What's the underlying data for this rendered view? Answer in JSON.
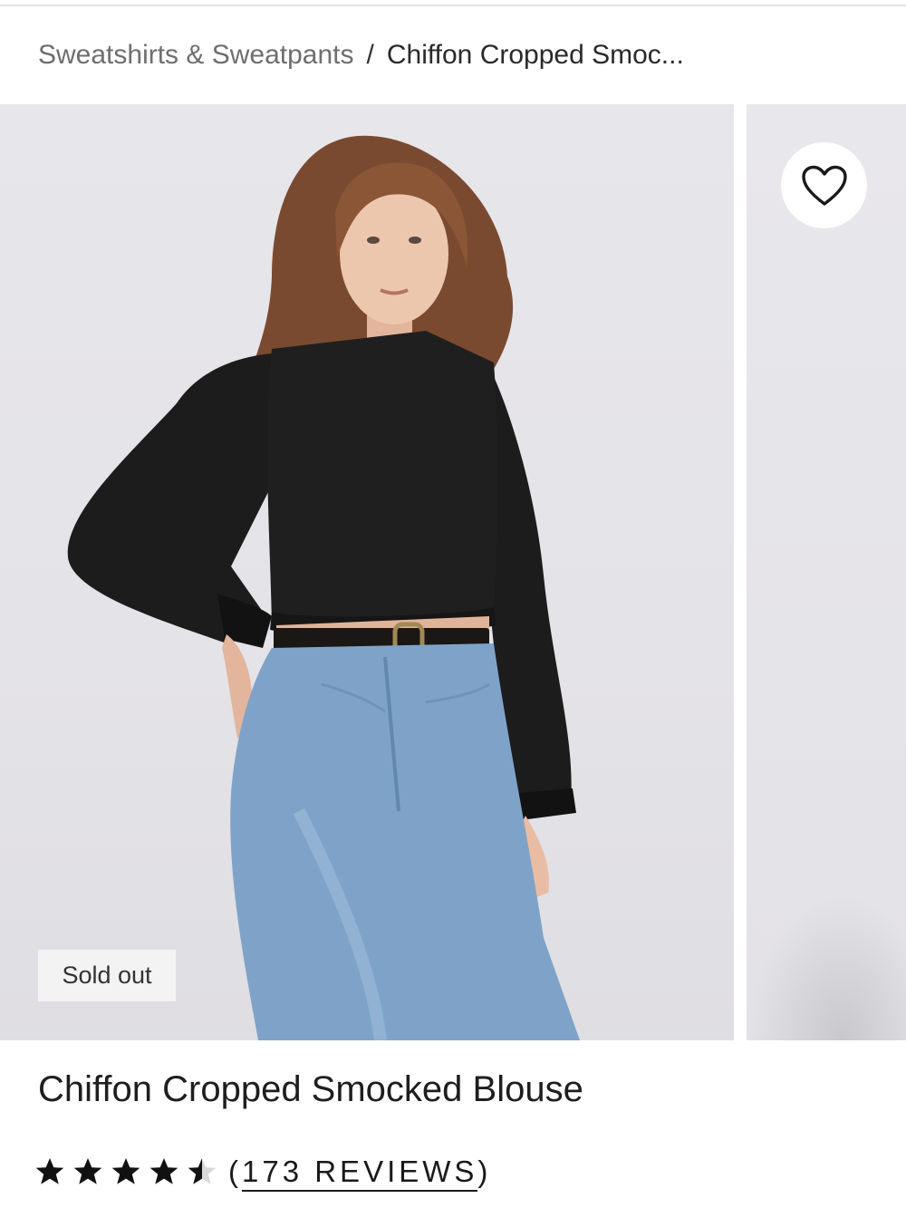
{
  "breadcrumb": {
    "parent": "Sweatshirts & Sweatpants",
    "separator": "/",
    "current": "Chiffon Cropped Smoc..."
  },
  "gallery": {
    "badge": "Sold out",
    "wishlist_icon": "heart-outline-icon"
  },
  "product": {
    "title": "Chiffon Cropped Smocked Blouse",
    "rating": 4.5,
    "rating_max": 5,
    "reviews_open": "(",
    "reviews_label": "173 REVIEWS",
    "reviews_close": ")"
  }
}
